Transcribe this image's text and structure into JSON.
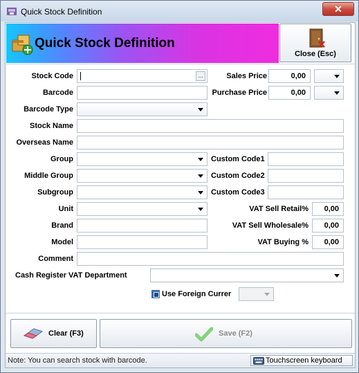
{
  "window": {
    "title": "Quick Stock Definition",
    "close_glyph": "✕"
  },
  "banner": {
    "title": "Quick Stock Definition",
    "icon": "stock-package-icon"
  },
  "close_button": {
    "label": "Close (Esc)",
    "icon": "exit-door-icon"
  },
  "fields": {
    "stock_code": {
      "label": "Stock Code",
      "value": "",
      "button": "..."
    },
    "barcode": {
      "label": "Barcode",
      "value": ""
    },
    "barcode_type": {
      "label": "Barcode Type",
      "value": ""
    },
    "stock_name": {
      "label": "Stock Name",
      "value": ""
    },
    "overseas_name": {
      "label": "Overseas Name",
      "value": ""
    },
    "group": {
      "label": "Group",
      "value": ""
    },
    "middle_group": {
      "label": "Middle Group",
      "value": ""
    },
    "subgroup": {
      "label": "Subgroup",
      "value": ""
    },
    "unit": {
      "label": "Unit",
      "value": ""
    },
    "brand": {
      "label": "Brand",
      "value": ""
    },
    "model": {
      "label": "Model",
      "value": ""
    },
    "comment": {
      "label": "Comment",
      "value": ""
    },
    "cash_register_vat": {
      "label": "Cash Register VAT Department",
      "value": ""
    }
  },
  "prices": {
    "sales_price": {
      "label": "Sales Price",
      "value": "0,00"
    },
    "purchase_price": {
      "label": "Purchase Price",
      "value": "0,00"
    }
  },
  "custom_codes": [
    {
      "label": "Custom Code1",
      "value": ""
    },
    {
      "label": "Custom Code2",
      "value": ""
    },
    {
      "label": "Custom Code3",
      "value": ""
    }
  ],
  "vat": {
    "sell_retail": {
      "label": "VAT Sell Retail%",
      "value": "0,00"
    },
    "sell_wholesale": {
      "label": "VAT Sell Wholesale%",
      "value": "0,00"
    },
    "buying": {
      "label": "VAT Buying %",
      "value": "0,00"
    }
  },
  "foreign_currency": {
    "label": "Use Foreign Currer",
    "checked": true,
    "value": ""
  },
  "buttons": {
    "clear": {
      "label": "Clear (F3)",
      "icon": "eraser-icon"
    },
    "save": {
      "label": "Save (F2)",
      "icon": "checkmark-icon",
      "enabled": false
    }
  },
  "status": {
    "note": "Note: You can search stock with barcode.",
    "keyboard_label": "Touchscreen keyboard",
    "keyboard_icon": "keyboard-icon"
  }
}
